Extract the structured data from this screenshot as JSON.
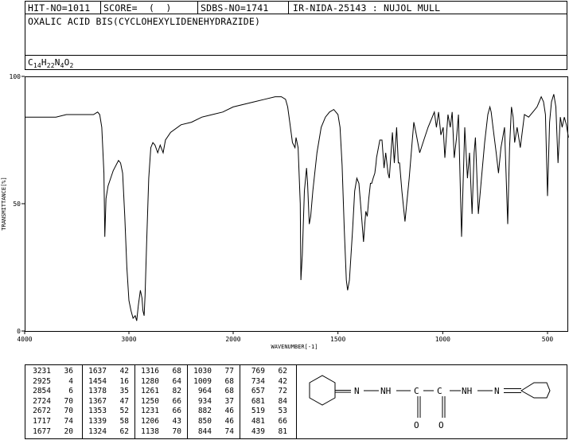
{
  "header": {
    "hit_no": "HIT-NO=1011",
    "score": "SCORE=  (  )",
    "sdbs_no": "SDBS-NO=1741",
    "ir_id": "IR-NIDA-25143 : NUJOL MULL",
    "compound_name": "OXALIC ACID BIS(CYCLOHEXYLIDENEHYDRAZIDE)",
    "formula": {
      "parts": [
        "C",
        "14",
        "H",
        "22",
        "N",
        "4",
        "O",
        "2"
      ]
    }
  },
  "chart_data": {
    "type": "line",
    "xlabel": "WAVENUMBER[-1]",
    "ylabel": "TRANSMITTANCE[%]",
    "xlim": [
      4000,
      400
    ],
    "ylim": [
      0,
      100
    ],
    "x_ticks": [
      4000,
      3000,
      2000,
      1500,
      1000,
      500
    ],
    "x_tick_labels": [
      "4000",
      "3000",
      "2000",
      "1500",
      "1000",
      "500"
    ],
    "y_ticks": [
      0,
      50,
      100
    ],
    "y_tick_labels": [
      "0",
      "50",
      "100"
    ],
    "grid": false,
    "line_color": "#000000",
    "spectrum": {
      "x": [
        4000,
        3900,
        3800,
        3700,
        3600,
        3500,
        3400,
        3340,
        3300,
        3280,
        3260,
        3240,
        3231,
        3220,
        3200,
        3150,
        3100,
        3080,
        3060,
        3040,
        3020,
        3000,
        2980,
        2960,
        2940,
        2925,
        2910,
        2890,
        2875,
        2866,
        2854,
        2845,
        2830,
        2810,
        2790,
        2770,
        2750,
        2724,
        2700,
        2672,
        2650,
        2600,
        2500,
        2400,
        2300,
        2200,
        2100,
        2000,
        1900,
        1850,
        1800,
        1770,
        1750,
        1740,
        1730,
        1717,
        1705,
        1700,
        1690,
        1680,
        1677,
        1670,
        1660,
        1650,
        1645,
        1637,
        1630,
        1620,
        1600,
        1580,
        1560,
        1540,
        1520,
        1500,
        1490,
        1480,
        1470,
        1460,
        1454,
        1445,
        1430,
        1420,
        1410,
        1400,
        1390,
        1378,
        1372,
        1367,
        1360,
        1353,
        1345,
        1339,
        1332,
        1324,
        1318,
        1316,
        1300,
        1290,
        1280,
        1272,
        1261,
        1255,
        1250,
        1240,
        1231,
        1220,
        1212,
        1206,
        1195,
        1180,
        1160,
        1145,
        1138,
        1128,
        1110,
        1090,
        1070,
        1050,
        1040,
        1030,
        1020,
        1009,
        998,
        990,
        975,
        964,
        955,
        945,
        934,
        925,
        910,
        895,
        882,
        872,
        860,
        850,
        844,
        830,
        815,
        800,
        785,
        775,
        769,
        760,
        745,
        734,
        722,
        705,
        690,
        681,
        672,
        664,
        657,
        645,
        630,
        610,
        590,
        570,
        550,
        540,
        530,
        519,
        510,
        500,
        490,
        481,
        470,
        460,
        450,
        439,
        430,
        420,
        410,
        400
      ],
      "y": [
        84,
        84,
        84,
        84,
        85,
        85,
        85,
        85,
        86,
        85,
        80,
        62,
        37,
        52,
        57,
        63,
        67,
        66,
        62,
        45,
        25,
        12,
        8,
        5,
        6,
        4,
        10,
        16,
        13,
        8,
        6,
        14,
        35,
        60,
        72,
        74,
        73,
        70,
        73,
        70,
        75,
        78,
        81,
        82,
        84,
        85,
        86,
        88,
        90,
        91,
        92,
        92,
        91,
        88,
        82,
        74,
        72,
        76,
        72,
        50,
        20,
        30,
        55,
        64,
        58,
        42,
        45,
        55,
        70,
        80,
        84,
        86,
        87,
        85,
        80,
        65,
        40,
        20,
        16,
        20,
        40,
        55,
        60,
        58,
        48,
        35,
        42,
        47,
        45,
        52,
        58,
        58,
        60,
        62,
        66,
        68,
        75,
        75,
        64,
        70,
        62,
        60,
        66,
        78,
        66,
        80,
        66,
        66,
        55,
        43,
        60,
        75,
        82,
        78,
        70,
        75,
        80,
        84,
        86,
        80,
        86,
        77,
        80,
        68,
        85,
        80,
        86,
        68,
        76,
        85,
        37,
        80,
        60,
        70,
        46,
        70,
        76,
        46,
        60,
        74,
        85,
        88,
        86,
        80,
        70,
        62,
        72,
        80,
        42,
        72,
        88,
        84,
        74,
        80,
        72,
        85,
        84,
        86,
        88,
        90,
        92,
        90,
        85,
        53,
        82,
        90,
        93,
        88,
        66,
        84,
        80,
        84,
        81,
        76,
        70,
        70
      ]
    },
    "peak_table": {
      "columns": [
        [
          [
            3231,
            36
          ],
          [
            2925,
            4
          ],
          [
            2854,
            6
          ],
          [
            2724,
            70
          ],
          [
            2672,
            70
          ],
          [
            1717,
            74
          ],
          [
            1677,
            20
          ]
        ],
        [
          [
            1637,
            42
          ],
          [
            1454,
            16
          ],
          [
            1378,
            35
          ],
          [
            1367,
            47
          ],
          [
            1353,
            52
          ],
          [
            1339,
            58
          ],
          [
            1324,
            62
          ]
        ],
        [
          [
            1316,
            68
          ],
          [
            1280,
            64
          ],
          [
            1261,
            82
          ],
          [
            1250,
            66
          ],
          [
            1231,
            66
          ],
          [
            1206,
            43
          ],
          [
            1138,
            70
          ]
        ],
        [
          [
            1030,
            77
          ],
          [
            1009,
            68
          ],
          [
            964,
            68
          ],
          [
            934,
            37
          ],
          [
            882,
            46
          ],
          [
            850,
            46
          ],
          [
            844,
            74
          ]
        ],
        [
          [
            769,
            62
          ],
          [
            734,
            42
          ],
          [
            657,
            72
          ],
          [
            681,
            84
          ],
          [
            519,
            53
          ],
          [
            481,
            66
          ],
          [
            439,
            81
          ]
        ]
      ]
    }
  },
  "structure": {
    "labels": {
      "n1": "N",
      "nh1": "NH",
      "c1": "C",
      "c2": "C",
      "nh2": "NH",
      "n2": "N",
      "o1": "O",
      "o2": "O"
    }
  }
}
